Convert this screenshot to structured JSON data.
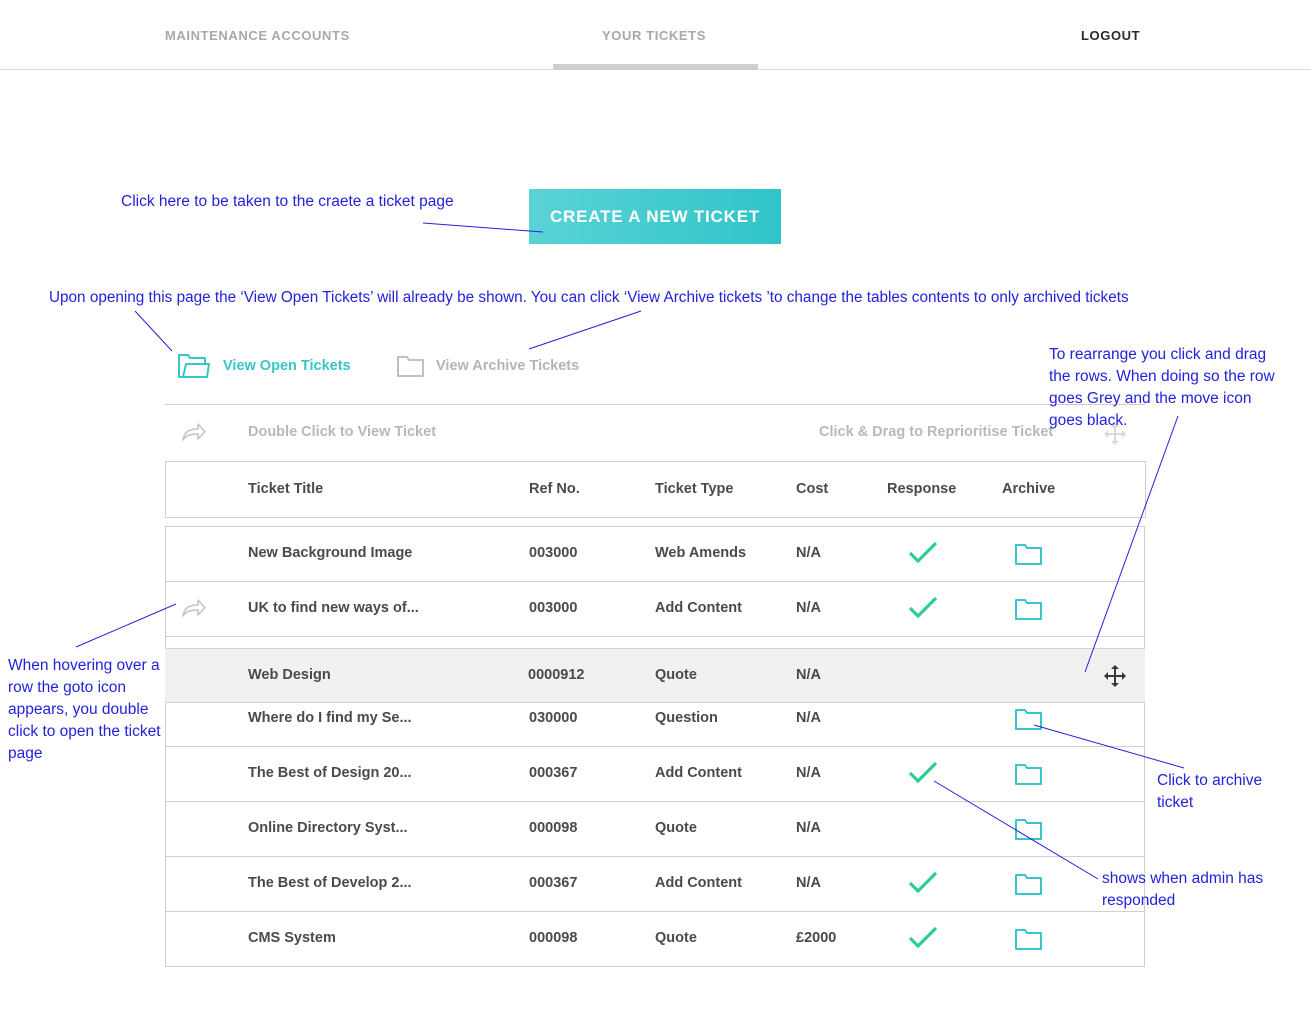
{
  "nav": {
    "maintenance": "MAINTENANCE ACCOUNTS",
    "tickets": "YOUR TICKETS",
    "logout": "LOGOUT"
  },
  "create_button": "CREATE A NEW TICKET",
  "tabs": {
    "open": "View Open Tickets",
    "archive": "View Archive Tickets"
  },
  "hints": {
    "double_click": "Double Click to View Ticket",
    "drag": "Click & Drag to Reprioritise Ticket"
  },
  "columns": [
    "Ticket Title",
    "Ref No.",
    "Ticket Type",
    "Cost",
    "Response",
    "Archive"
  ],
  "rows": [
    {
      "title": "New Background Image",
      "ref": "003000",
      "type": "Web Amends",
      "cost": "N/A",
      "response": true,
      "archive": true
    },
    {
      "title": "UK to find new ways of...",
      "ref": "003000",
      "type": "Add Content",
      "cost": "N/A",
      "response": true,
      "archive": true
    },
    {
      "title": "Web Design",
      "ref": "0000912",
      "type": "Quote",
      "cost": "N/A",
      "response": false,
      "archive": false
    },
    {
      "title": "Where do I find my Se...",
      "ref": "030000",
      "type": "Question",
      "cost": "N/A",
      "response": false,
      "archive": true
    },
    {
      "title": "The Best of Design 20...",
      "ref": "000367",
      "type": "Add Content",
      "cost": "N/A",
      "response": true,
      "archive": true
    },
    {
      "title": "Online Directory Syst...",
      "ref": "000098",
      "type": "Quote",
      "cost": "N/A",
      "response": false,
      "archive": true
    },
    {
      "title": "The Best of Develop 2...",
      "ref": "000367",
      "type": "Add Content",
      "cost": "N/A",
      "response": true,
      "archive": true
    },
    {
      "title": "CMS System",
      "ref": "000098",
      "type": "Quote",
      "cost": "£2000",
      "response": true,
      "archive": true
    }
  ],
  "annotations": {
    "create": "Click here to be taken to the craete a ticket page",
    "view": "Upon opening this page the ‘View Open Tickets’ will already be shown. You can click ‘View Archive tickets ’to change the tables contents to only archived tickets",
    "rearrange": "To rearrange you click and drag the rows. When doing so the row goes Grey and the move icon goes black.",
    "hover": "When hovering over a row the goto icon appears, you double click to open the ticket page",
    "archive": "Click to archive ticket",
    "response": "shows when admin has responded"
  },
  "colors": {
    "accent": "#38c5c9",
    "check": "#2ecc9b",
    "annotation": "#2222dd"
  },
  "icons": {
    "goto": "share-arrow-icon",
    "move": "move-arrows-icon",
    "folder": "folder-icon",
    "check": "check-icon"
  }
}
